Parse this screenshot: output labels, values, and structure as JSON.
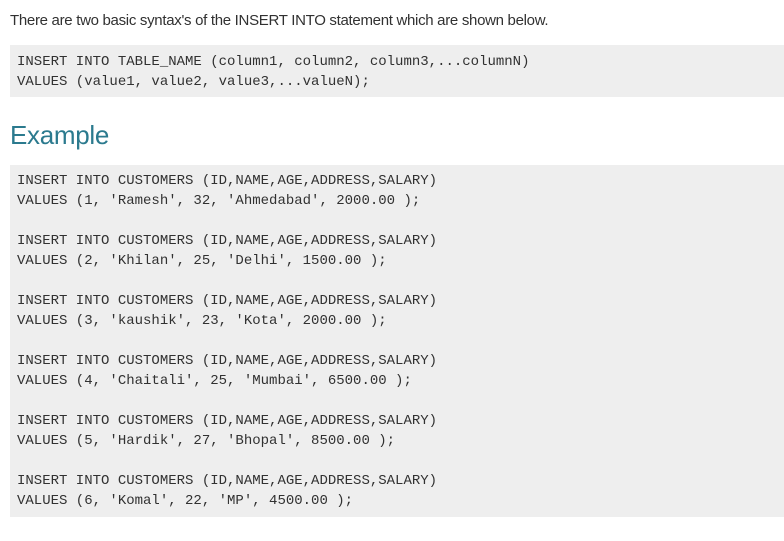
{
  "intro_text": "There are two basic syntax's of the INSERT INTO statement which are shown below.",
  "syntax": {
    "line1": "INSERT INTO TABLE_NAME (column1, column2, column3,...columnN)",
    "line2": "VALUES (value1, value2, value3,...valueN);"
  },
  "example_heading": "Example",
  "examples": [
    {
      "insert": "INSERT INTO CUSTOMERS (ID,NAME,AGE,ADDRESS,SALARY)",
      "values": "VALUES (1, 'Ramesh', 32, 'Ahmedabad', 2000.00 );"
    },
    {
      "insert": "INSERT INTO CUSTOMERS (ID,NAME,AGE,ADDRESS,SALARY)",
      "values": "VALUES (2, 'Khilan', 25, 'Delhi', 1500.00 );"
    },
    {
      "insert": "INSERT INTO CUSTOMERS (ID,NAME,AGE,ADDRESS,SALARY)",
      "values": "VALUES (3, 'kaushik', 23, 'Kota', 2000.00 );"
    },
    {
      "insert": "INSERT INTO CUSTOMERS (ID,NAME,AGE,ADDRESS,SALARY)",
      "values": "VALUES (4, 'Chaitali', 25, 'Mumbai', 6500.00 );"
    },
    {
      "insert": "INSERT INTO CUSTOMERS (ID,NAME,AGE,ADDRESS,SALARY)",
      "values": "VALUES (5, 'Hardik', 27, 'Bhopal', 8500.00 );"
    },
    {
      "insert": "INSERT INTO CUSTOMERS (ID,NAME,AGE,ADDRESS,SALARY)",
      "values": "VALUES (6, 'Komal', 22, 'MP', 4500.00 );"
    }
  ]
}
